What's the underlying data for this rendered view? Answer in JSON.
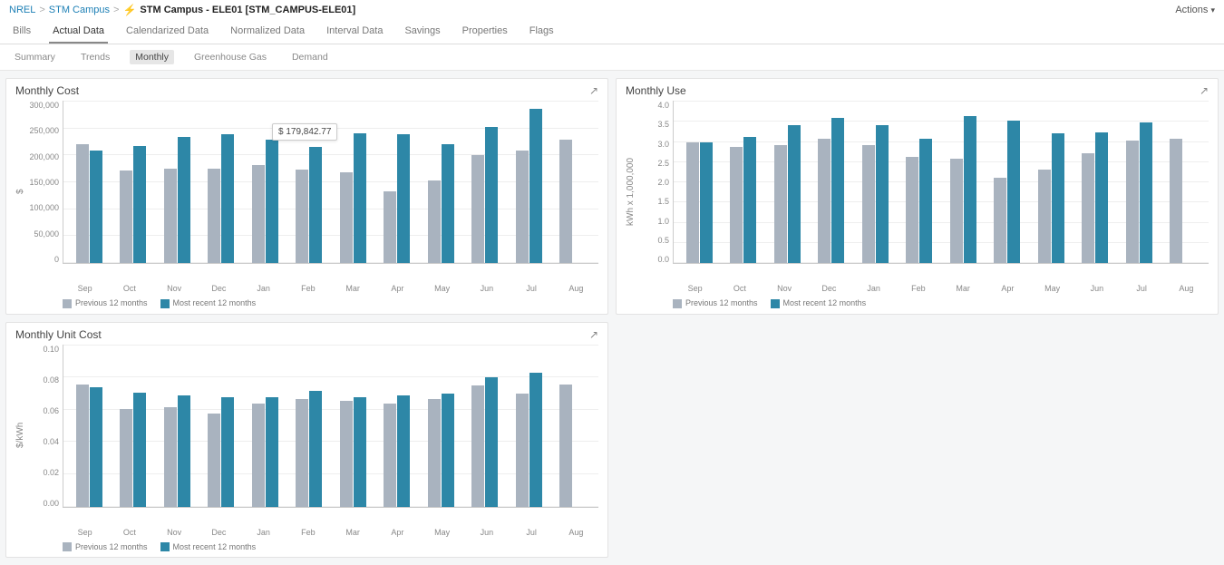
{
  "breadcrumb": {
    "level1": "NREL",
    "level2": "STM Campus",
    "title": "STM Campus - ELE01 [STM_CAMPUS-ELE01]"
  },
  "actions_label": "Actions",
  "tabs_primary": [
    "Bills",
    "Actual Data",
    "Calendarized Data",
    "Normalized Data",
    "Interval Data",
    "Savings",
    "Properties",
    "Flags"
  ],
  "tabs_primary_active": 1,
  "tabs_secondary": [
    "Summary",
    "Trends",
    "Monthly",
    "Greenhouse Gas",
    "Demand"
  ],
  "tabs_secondary_active": 2,
  "legend": {
    "prev": "Previous 12 months",
    "recent": "Most recent 12 months"
  },
  "tooltip_value": "$ 179,842.77",
  "charts": {
    "cost": {
      "title": "Monthly Cost",
      "ylabel": "$",
      "ymax": 300000,
      "yticks": [
        "300,000",
        "250,000",
        "200,000",
        "150,000",
        "100,000",
        "50,000",
        "0"
      ]
    },
    "use": {
      "title": "Monthly Use",
      "ylabel": "kWh x 1,000,000",
      "ymax": 4.0,
      "yticks": [
        "4.0",
        "3.5",
        "3.0",
        "2.5",
        "2.0",
        "1.5",
        "1.0",
        "0.5",
        "0.0"
      ]
    },
    "unitcost": {
      "title": "Monthly Unit Cost",
      "ylabel": "$/kWh",
      "ymax": 0.1,
      "yticks": [
        "0.10",
        "0.08",
        "0.06",
        "0.04",
        "0.02",
        "0.00"
      ]
    }
  },
  "chart_data": [
    {
      "type": "bar",
      "title": "Monthly Cost",
      "ylabel": "$",
      "xlabel": "",
      "ylim": [
        0,
        300000
      ],
      "categories": [
        "Sep",
        "Oct",
        "Nov",
        "Dec",
        "Jan",
        "Feb",
        "Mar",
        "Apr",
        "May",
        "Jun",
        "Jul",
        "Aug"
      ],
      "series": [
        {
          "name": "Previous 12 months",
          "values": [
            218000,
            170000,
            174000,
            173000,
            180000,
            171000,
            166000,
            131000,
            152000,
            198000,
            207000,
            226000
          ]
        },
        {
          "name": "Most recent 12 months",
          "values": [
            207000,
            215000,
            231000,
            237000,
            226000,
            214000,
            239000,
            236000,
            219000,
            250000,
            284000,
            null
          ]
        }
      ]
    },
    {
      "type": "bar",
      "title": "Monthly Use",
      "ylabel": "kWh x 1,000,000",
      "xlabel": "",
      "ylim": [
        0,
        4.0
      ],
      "categories": [
        "Sep",
        "Oct",
        "Nov",
        "Dec",
        "Jan",
        "Feb",
        "Mar",
        "Apr",
        "May",
        "Jun",
        "Jul",
        "Aug"
      ],
      "series": [
        {
          "name": "Previous 12 months",
          "values": [
            2.95,
            2.85,
            2.9,
            3.05,
            2.9,
            2.6,
            2.55,
            2.1,
            2.3,
            2.7,
            3.0,
            3.05
          ]
        },
        {
          "name": "Most recent 12 months",
          "values": [
            2.95,
            3.1,
            3.38,
            3.55,
            3.38,
            3.05,
            3.6,
            3.48,
            3.18,
            3.2,
            3.45,
            null
          ]
        }
      ]
    },
    {
      "type": "bar",
      "title": "Monthly Unit Cost",
      "ylabel": "$/kWh",
      "xlabel": "",
      "ylim": [
        0,
        0.1
      ],
      "categories": [
        "Sep",
        "Oct",
        "Nov",
        "Dec",
        "Jan",
        "Feb",
        "Mar",
        "Apr",
        "May",
        "Jun",
        "Jul",
        "Aug"
      ],
      "series": [
        {
          "name": "Previous 12 months",
          "values": [
            0.075,
            0.06,
            0.061,
            0.057,
            0.063,
            0.066,
            0.065,
            0.063,
            0.066,
            0.074,
            0.069,
            0.075
          ]
        },
        {
          "name": "Most recent 12 months",
          "values": [
            0.073,
            0.07,
            0.068,
            0.067,
            0.067,
            0.071,
            0.067,
            0.068,
            0.069,
            0.079,
            0.082,
            null
          ]
        }
      ]
    }
  ]
}
